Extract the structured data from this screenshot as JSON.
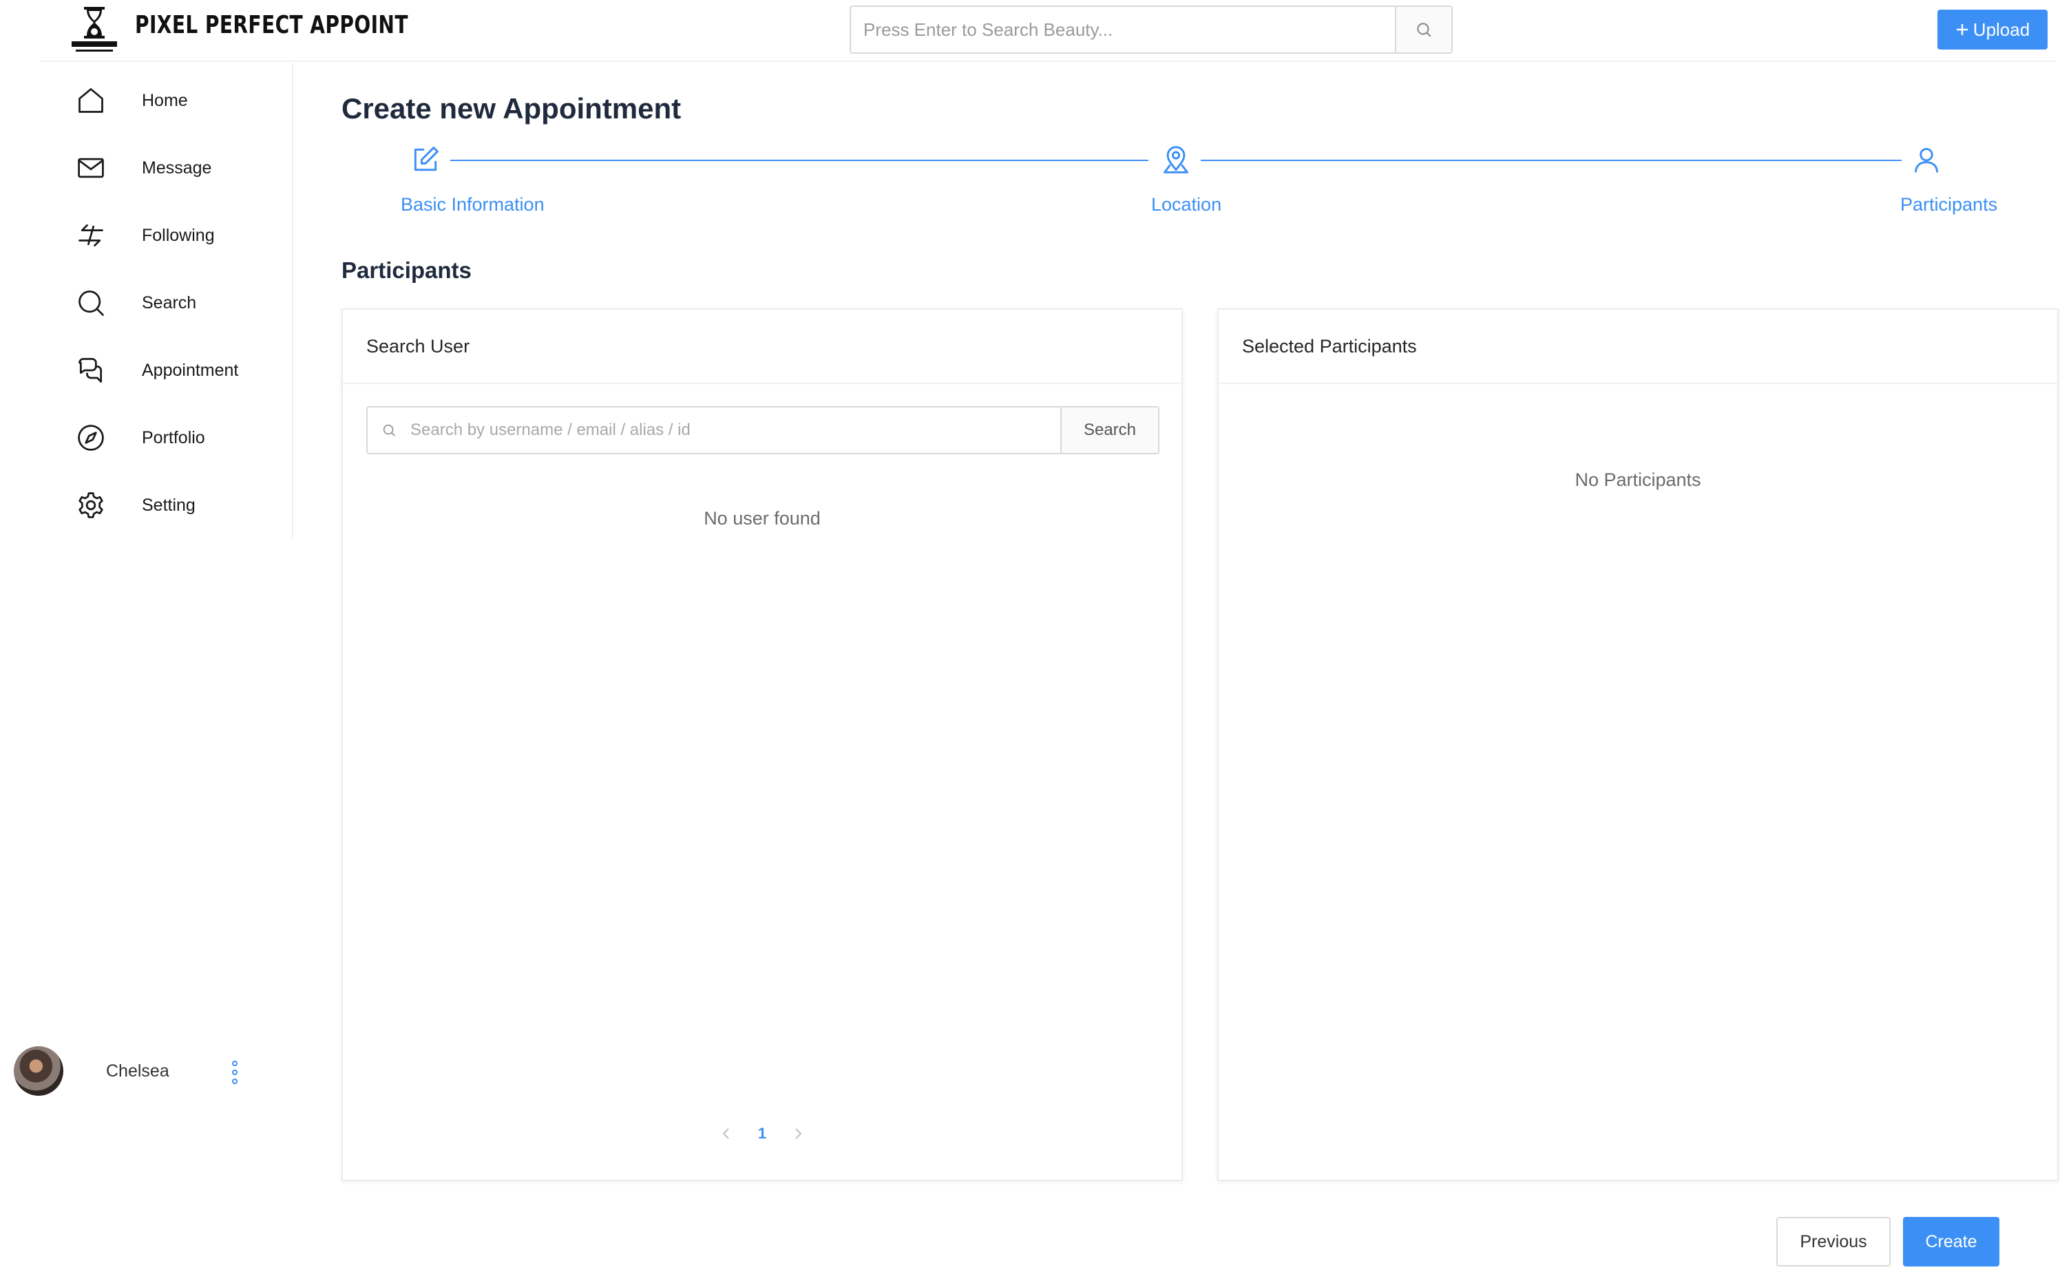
{
  "header": {
    "brand": "PIXEL PERFECT APPOINT",
    "search_placeholder": "Press Enter to Search Beauty...",
    "upload_label": "Upload",
    "upload_icon": "plus-icon",
    "search_icon": "search-icon"
  },
  "sidebar": {
    "items": [
      {
        "label": "Home",
        "icon": "home-icon"
      },
      {
        "label": "Message",
        "icon": "mail-icon"
      },
      {
        "label": "Following",
        "icon": "following-arrows-icon"
      },
      {
        "label": "Search",
        "icon": "search-icon"
      },
      {
        "label": "Appointment",
        "icon": "chat-icon"
      },
      {
        "label": "Portfolio",
        "icon": "compass-icon"
      },
      {
        "label": "Setting",
        "icon": "gear-icon"
      }
    ],
    "user": {
      "name": "Chelsea",
      "menu_icon": "more-vertical-icon"
    }
  },
  "main": {
    "title": "Create new Appointment",
    "steps": [
      {
        "label": "Basic Information",
        "icon": "edit-icon"
      },
      {
        "label": "Location",
        "icon": "map-pin-icon"
      },
      {
        "label": "Participants",
        "icon": "user-icon"
      }
    ],
    "section_title": "Participants",
    "search_panel": {
      "title": "Search User",
      "placeholder": "Search by username / email / alias / id",
      "search_button": "Search",
      "empty_text": "No user found",
      "current_page": "1"
    },
    "selected_panel": {
      "title": "Selected Participants",
      "empty_text": "No Participants"
    },
    "actions": {
      "previous": "Previous",
      "create": "Create"
    }
  },
  "colors": {
    "accent": "#3b8ff5",
    "text_dark": "#1f2a3c",
    "border": "#d9d9d9"
  }
}
